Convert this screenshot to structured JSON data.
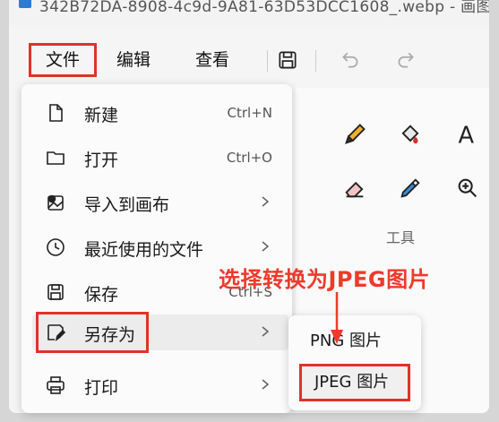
{
  "window": {
    "title": "342B72DA-8908-4c9d-9A81-63D53DCC1608_.webp - 画图"
  },
  "menubar": {
    "file": "文件",
    "edit": "编辑",
    "view": "查看"
  },
  "file_menu": {
    "items": [
      {
        "label": "新建",
        "shortcut": "Ctrl+N",
        "icon": "new-file-icon"
      },
      {
        "label": "打开",
        "shortcut": "Ctrl+O",
        "icon": "folder-icon"
      },
      {
        "label": "导入到画布",
        "icon": "import-image-icon"
      },
      {
        "label": "最近使用的文件",
        "icon": "clock-icon"
      },
      {
        "label": "保存",
        "shortcut": "Ctrl+S",
        "icon": "save-icon"
      },
      {
        "label": "另存为",
        "icon": "save-as-icon"
      },
      {
        "label": "打印",
        "icon": "printer-icon"
      }
    ]
  },
  "save_as_submenu": {
    "items": [
      {
        "label": "PNG 图片"
      },
      {
        "label": "JPEG 图片"
      }
    ]
  },
  "tools_panel": {
    "label": "工具"
  },
  "annotation": {
    "text": "选择转换为JPEG图片",
    "color": "#ee3a2c"
  },
  "colors": {
    "highlight_border": "#e0322a"
  }
}
